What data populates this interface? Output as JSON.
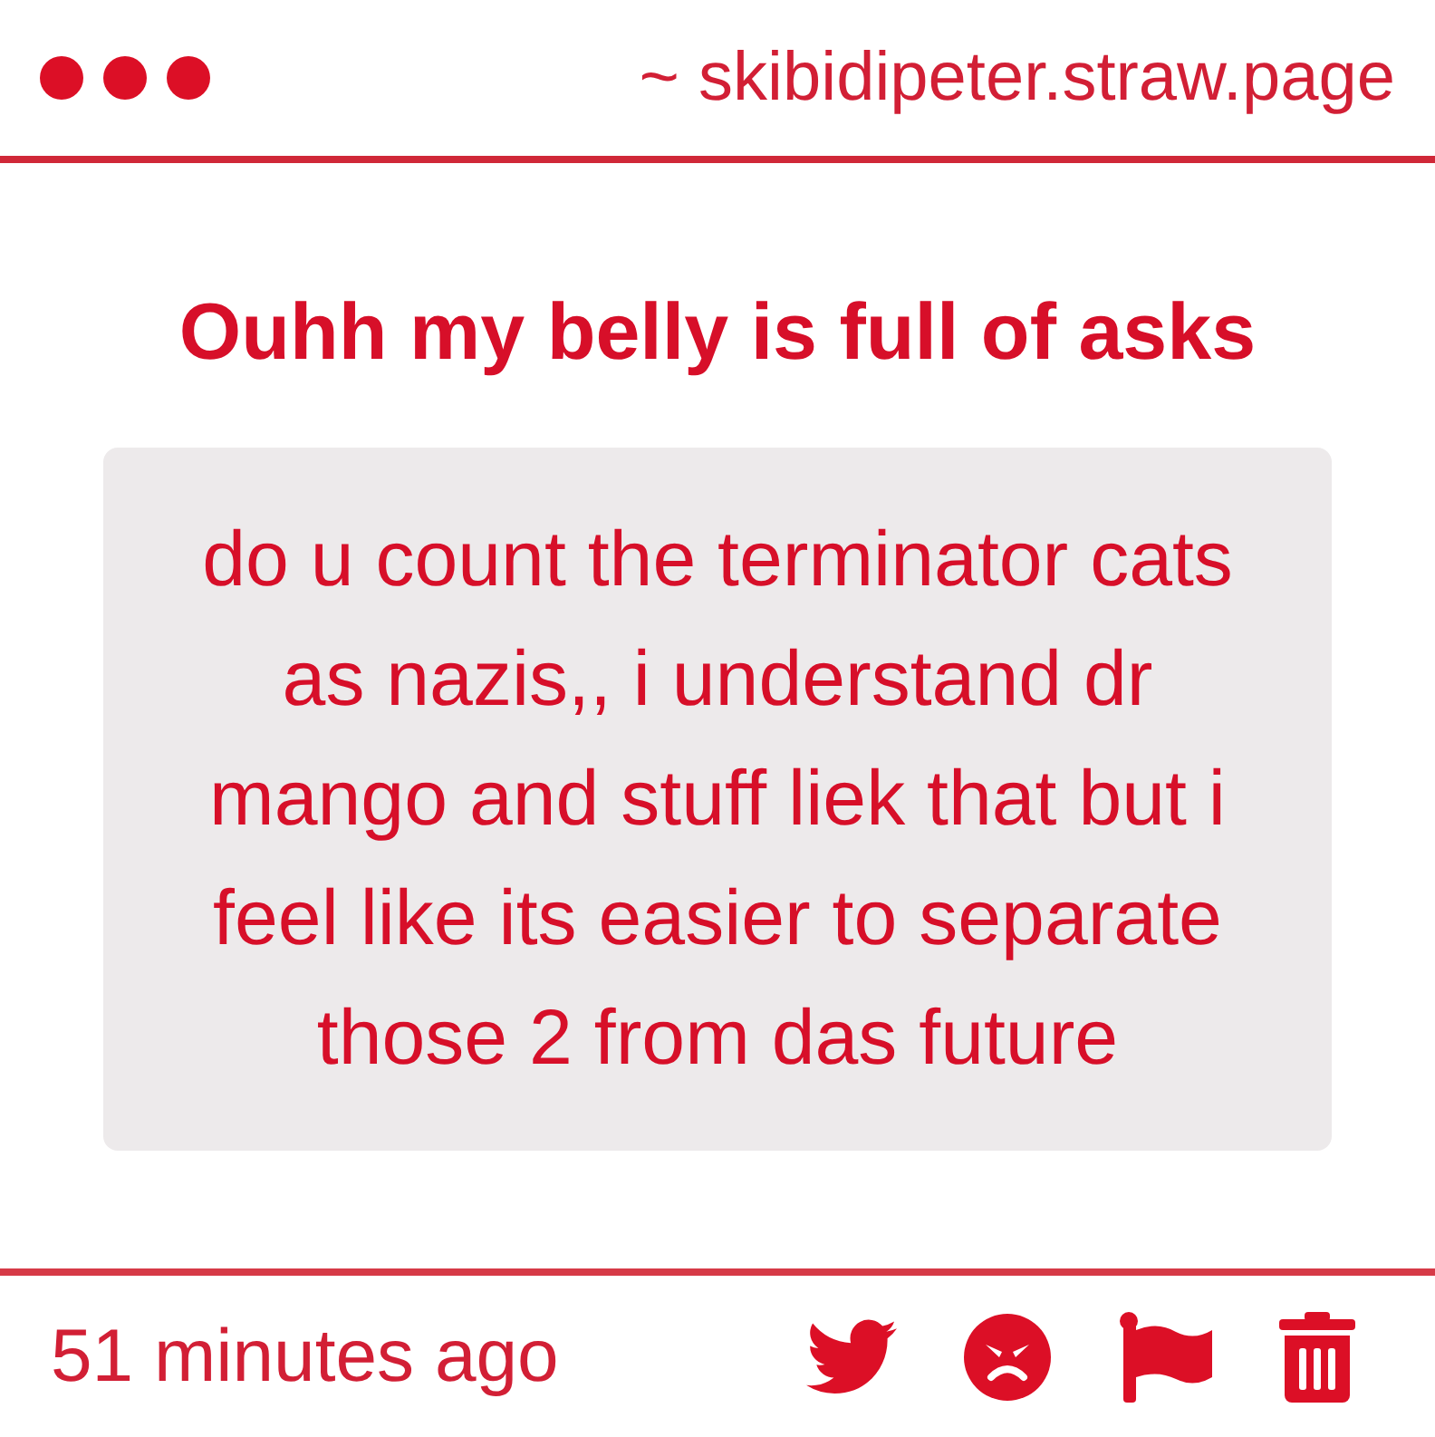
{
  "header": {
    "url": "~ skibidipeter.straw.page"
  },
  "title": "Ouhh my belly is full of asks",
  "question": "do u count the terminator cats as nazis,, i understand dr mango and stuff liek that but i feel like its easier to separate those 2 from das future",
  "footer": {
    "time": "51 minutes ago"
  }
}
